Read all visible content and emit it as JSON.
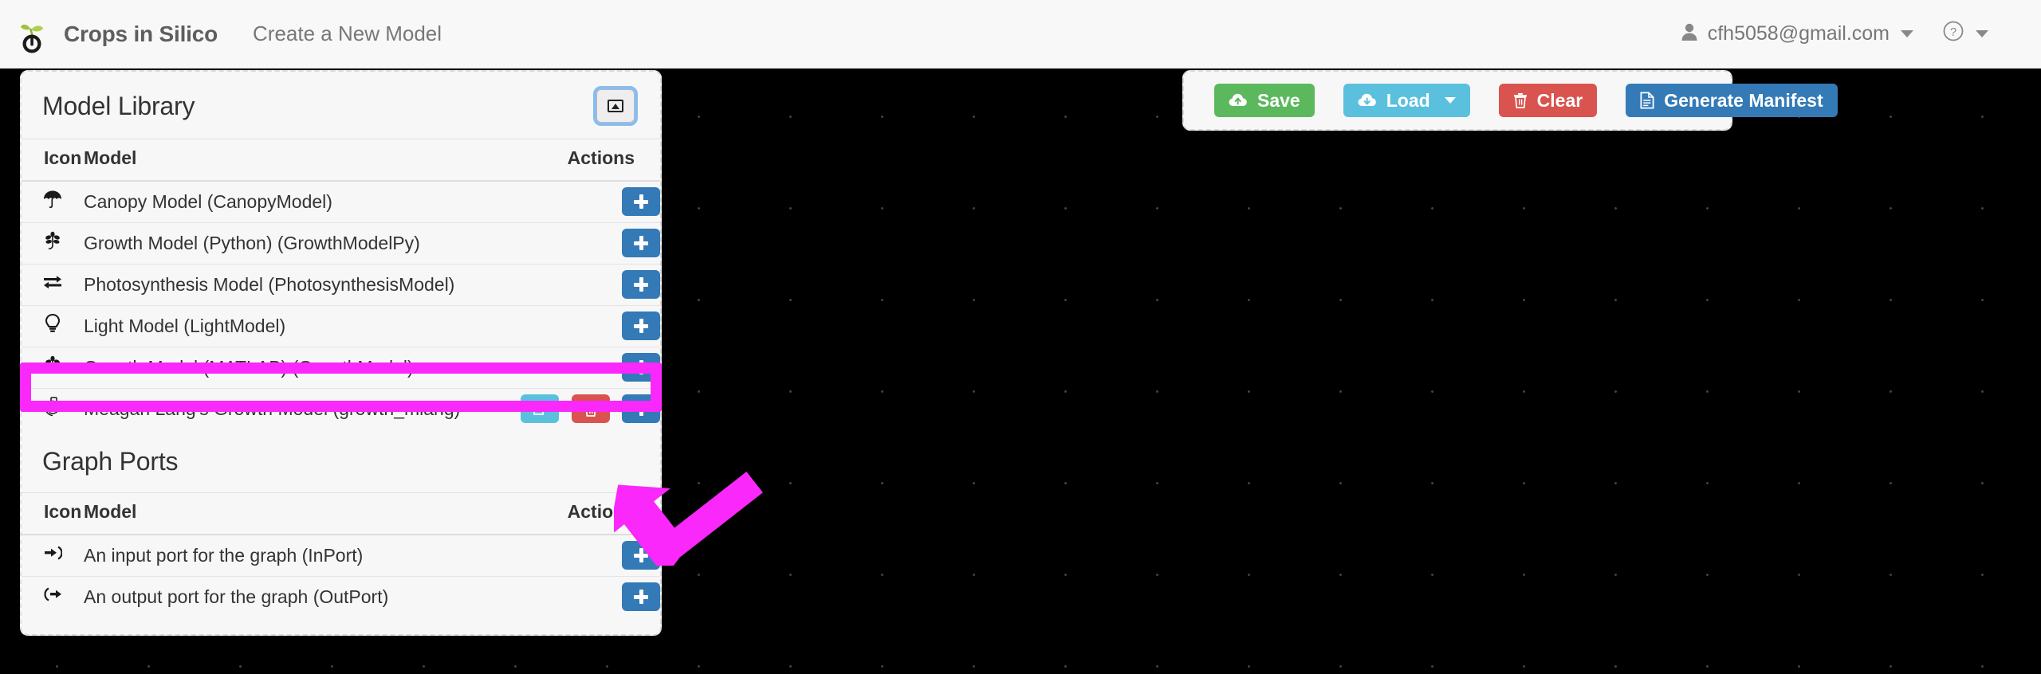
{
  "navbar": {
    "logo_icon": "sprout-power-logo",
    "brand": "Crops in Silico",
    "subtitle": "Create a New Model",
    "user_icon": "user-icon",
    "user_email": "cfh5058@gmail.com",
    "help_icon": "question-circle-icon"
  },
  "toolbar": {
    "save_label": "Save",
    "save_icon": "cloud-upload-icon",
    "save_color": "#5cb85c",
    "load_label": "Load",
    "load_icon": "cloud-download-icon",
    "load_color": "#5bc0de",
    "clear_label": "Clear",
    "clear_icon": "trash-icon",
    "clear_color": "#d9534f",
    "manifest_label": "Generate Manifest",
    "manifest_icon": "file-text-icon",
    "manifest_color": "#337ab7"
  },
  "model_library": {
    "title": "Model Library",
    "collapse_icon": "collapse-window-icon",
    "columns": {
      "icon": "Icon",
      "model": "Model",
      "actions": "Actions"
    },
    "rows": [
      {
        "icon": "umbrella-icon",
        "glyph": "☂",
        "label": "Canopy Model (CanopyModel)",
        "actions": [
          "add"
        ]
      },
      {
        "icon": "leaf-icon",
        "glyph": "⚘",
        "label": "Growth Model (Python) (GrowthModelPy)",
        "actions": [
          "add"
        ]
      },
      {
        "icon": "exchange-icon",
        "glyph": "⇄",
        "label": "Photosynthesis Model (PhotosynthesisModel)",
        "actions": [
          "add"
        ]
      },
      {
        "icon": "lightbulb-icon",
        "glyph": "Ὂ1",
        "label": "Light Model (LightModel)",
        "actions": [
          "add"
        ]
      },
      {
        "icon": "leaf-icon",
        "glyph": "⚘",
        "label": "Growth Model (MATLAB) (GrowthModel)",
        "actions": [
          "add"
        ]
      },
      {
        "icon": "fingerprint-icon",
        "glyph": "࿐",
        "label": "Meagan Lang's Growth Model (growth_mlang)",
        "actions": [
          "edit",
          "delete",
          "add"
        ],
        "highlighted": true
      }
    ]
  },
  "graph_ports": {
    "title": "Graph Ports",
    "columns": {
      "icon": "Icon",
      "model": "Model",
      "actions": "Actions"
    },
    "rows": [
      {
        "icon": "sign-in-icon",
        "glyph": "➡",
        "label": "An input port for the graph (InPort)",
        "actions": [
          "add"
        ]
      },
      {
        "icon": "sign-out-icon",
        "glyph": "➡",
        "label": "An output port for the graph (OutPort)",
        "actions": [
          "add"
        ]
      }
    ]
  },
  "annotation": {
    "highlight_color": "#fa28fa",
    "target": "Meagan Lang's Growth Model (growth_mlang)",
    "arrow_icon": "annotation-arrow-icon"
  },
  "canvas": {
    "background_color": "#000000",
    "grid_dot_color": "#444444"
  }
}
